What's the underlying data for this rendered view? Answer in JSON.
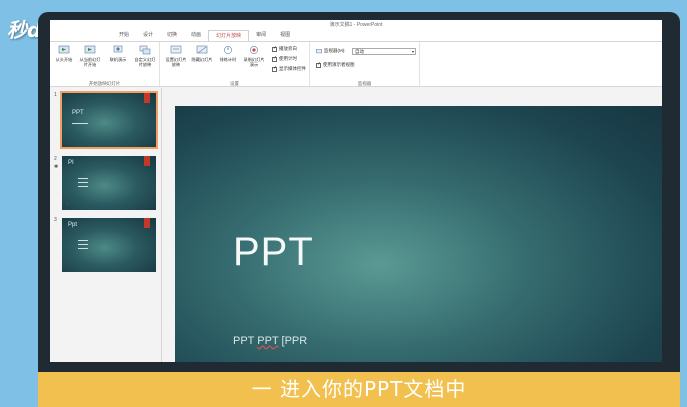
{
  "watermark": "秒dōng视频",
  "window_title": "演示文稿1 - PowerPoint",
  "tabs": [
    "开始",
    "设计",
    "切换",
    "动画",
    "幻灯片放映",
    "审阅",
    "视图"
  ],
  "active_tab_index": 4,
  "ribbon": {
    "groups": [
      {
        "label": "开始放映幻灯片",
        "buttons": [
          "从头开始",
          "从当前幻灯片开始",
          "联机演示",
          "自定义幻灯片放映"
        ]
      },
      {
        "label": "设置",
        "buttons": [
          "设置幻灯片放映",
          "隐藏幻灯片",
          "排练计时",
          "录制幻灯片演示"
        ],
        "checkboxes": [
          "播放旁白",
          "使用计时",
          "显示媒体控件"
        ]
      },
      {
        "label": "监视器",
        "monitor_label": "监视器(M):",
        "monitor_value": "自动",
        "presenter_view": "使用演示者视图"
      }
    ]
  },
  "thumbnails": [
    {
      "num": "1",
      "title": "PPT",
      "selected": true
    },
    {
      "num": "2",
      "title": "PI",
      "selected": false
    },
    {
      "num": "3",
      "title": "Ppt",
      "selected": false
    }
  ],
  "slide": {
    "title": "PPT",
    "subtitle_a": "PPT ",
    "subtitle_b": "PPT",
    "subtitle_c": " [PPR"
  },
  "caption": "一 进入你的PPT文档中",
  "colors": {
    "background": "#7fc0e6",
    "accent": "#c0504d",
    "caption_bar": "#f1c04e"
  }
}
